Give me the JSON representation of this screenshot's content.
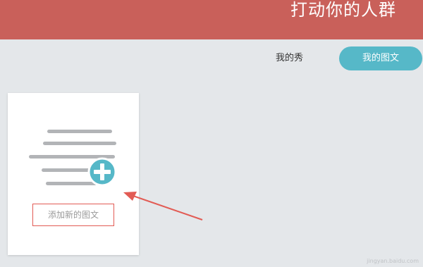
{
  "header": {
    "title": "打动你的人群"
  },
  "tabs": {
    "my_show": "我的秀",
    "my_articles": "我的图文"
  },
  "card": {
    "icon": "article-add-icon",
    "add_label": "添加新的图文"
  },
  "colors": {
    "header_bg": "#c9605a",
    "accent": "#56b8c8",
    "annotation_red": "#e25b54"
  },
  "watermark": "jingyan.baidu.com"
}
